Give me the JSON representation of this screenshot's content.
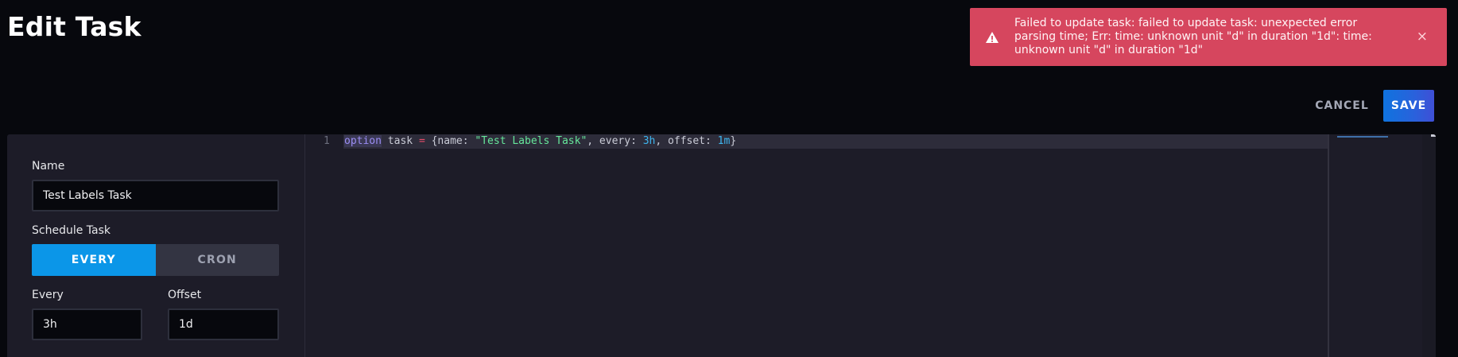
{
  "page": {
    "title": "Edit Task"
  },
  "notification": {
    "message": "Failed to update task: failed to update task: unexpected error parsing time; Err: time: unknown unit \"d\" in duration \"1d\": time: unknown unit \"d\" in duration \"1d\"",
    "icon": "warning-icon",
    "close_glyph": "×",
    "color": "#d6465e"
  },
  "header": {
    "cancel_label": "CANCEL",
    "save_label": "SAVE"
  },
  "form": {
    "name_label": "Name",
    "name_value": "Test Labels Task",
    "schedule_label": "Schedule Task",
    "schedule_options": [
      "EVERY",
      "CRON"
    ],
    "schedule_selected": "EVERY",
    "every_label": "Every",
    "every_value": "3h",
    "offset_label": "Offset",
    "offset_value": "1d"
  },
  "editor": {
    "line_number": "1",
    "tokens": {
      "kw": "option",
      "t1": " task ",
      "op": "=",
      "t2": " {name: ",
      "str": "\"Test Labels Task\"",
      "t3": ", every: ",
      "num1": "3h",
      "t4": ", offset: ",
      "num2": "1m",
      "t5": "}"
    }
  },
  "colors": {
    "accent_toggle": "#0b96e8",
    "save_button": "#2962dc",
    "background": "#07080d",
    "panel": "#1d1c28"
  }
}
